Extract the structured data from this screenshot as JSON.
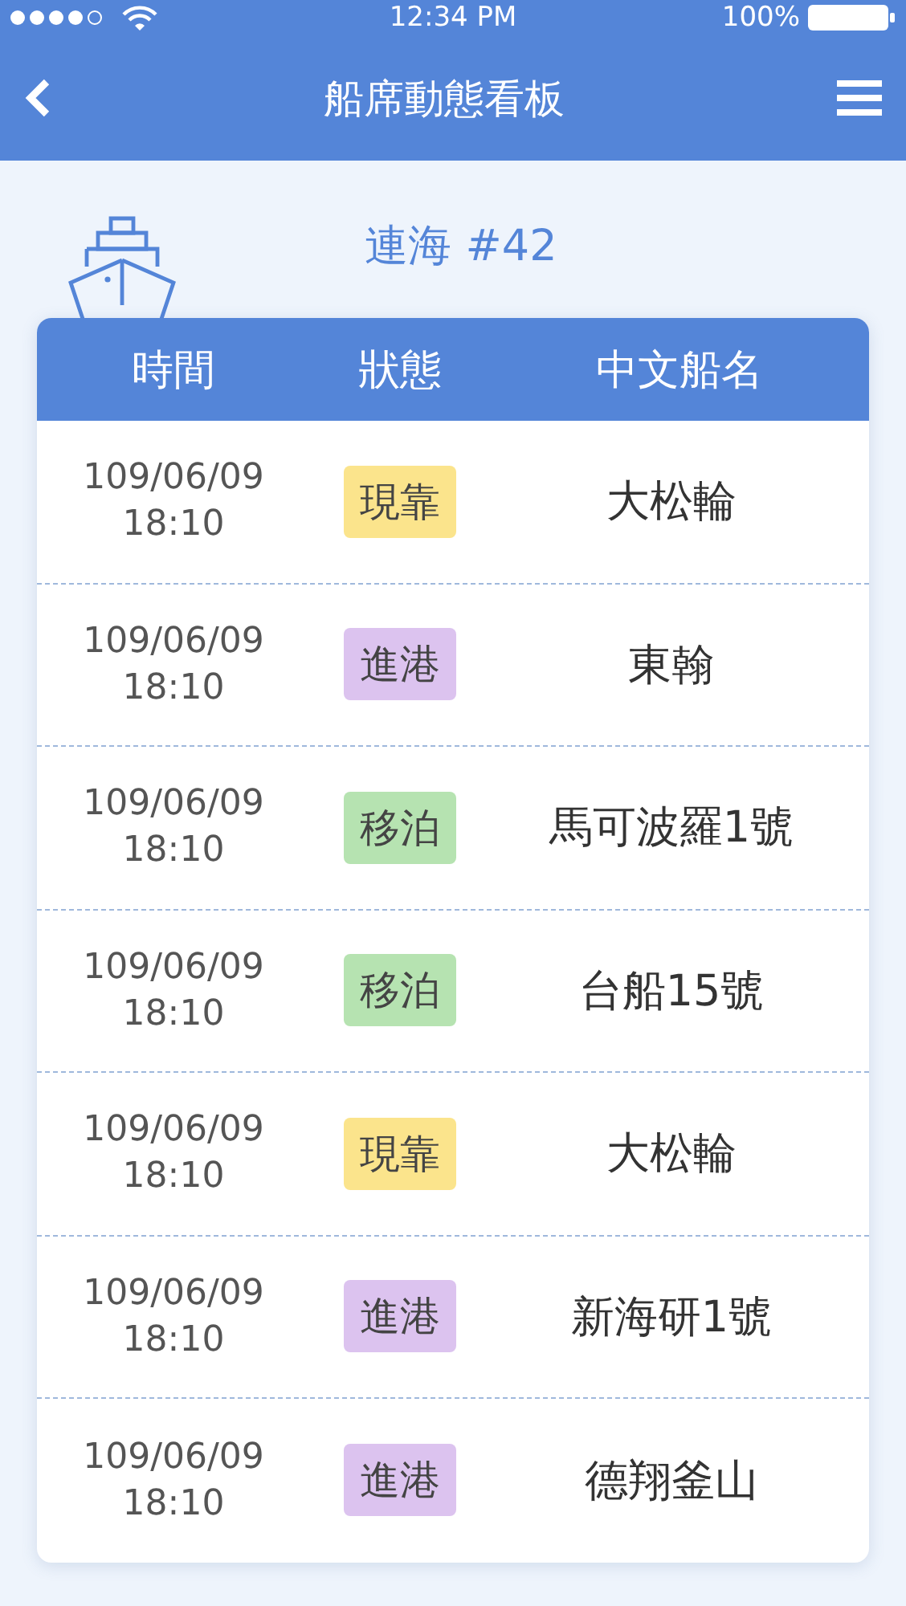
{
  "status_bar": {
    "time": "12:34 PM",
    "battery": "100%"
  },
  "nav": {
    "title": "船席動態看板"
  },
  "berth": {
    "title": "連海 #42"
  },
  "table": {
    "columns": [
      "時間",
      "狀態",
      "中文船名"
    ],
    "rows": [
      {
        "date": "109/06/09",
        "time": "18:10",
        "status": "現靠",
        "color": "#fbe48c",
        "ship": "大松輪"
      },
      {
        "date": "109/06/09",
        "time": "18:10",
        "status": "進港",
        "color": "#dcc3ef",
        "ship": "東翰"
      },
      {
        "date": "109/06/09",
        "time": "18:10",
        "status": "移泊",
        "color": "#b6e3b1",
        "ship": "馬可波羅1號"
      },
      {
        "date": "109/06/09",
        "time": "18:10",
        "status": "移泊",
        "color": "#b6e3b1",
        "ship": "台船15號"
      },
      {
        "date": "109/06/09",
        "time": "18:10",
        "status": "現靠",
        "color": "#fbe48c",
        "ship": "大松輪"
      },
      {
        "date": "109/06/09",
        "time": "18:10",
        "status": "進港",
        "color": "#dcc3ef",
        "ship": "新海研1號"
      },
      {
        "date": "109/06/09",
        "time": "18:10",
        "status": "進港",
        "color": "#dcc3ef",
        "ship": "德翔釜山"
      }
    ]
  }
}
